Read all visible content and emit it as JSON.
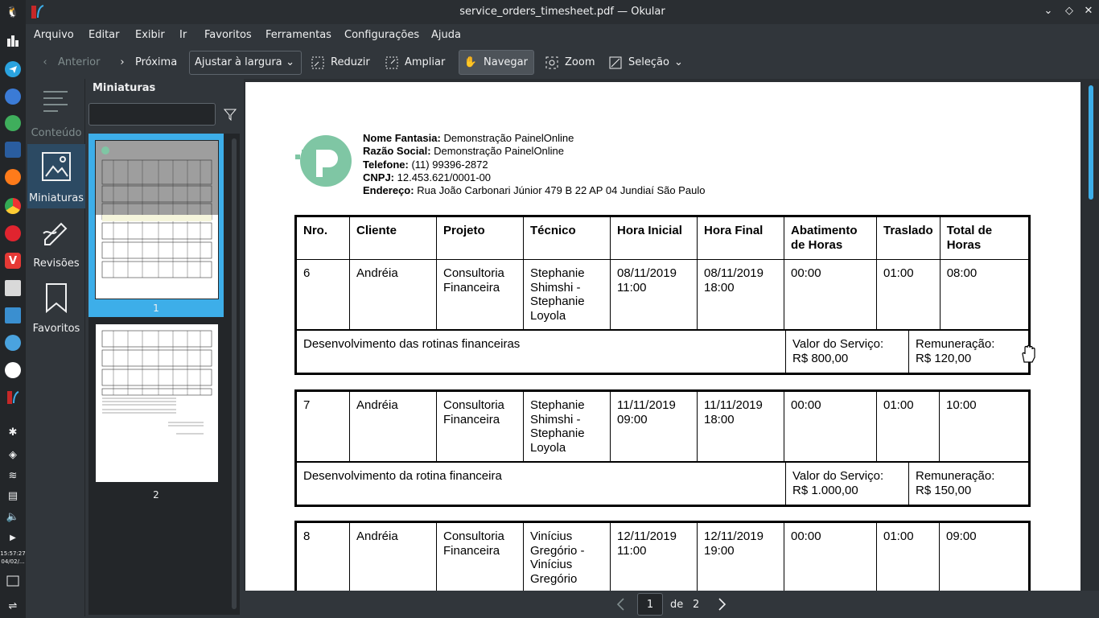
{
  "window": {
    "title": "service_orders_timesheet.pdf — Okular"
  },
  "menu": [
    "Arquivo",
    "Editar",
    "Exibir",
    "Ir",
    "Favoritos",
    "Ferramentas",
    "Configurações",
    "Ajuda"
  ],
  "toolbar": {
    "previous": "Anterior",
    "next": "Próxima",
    "zoom_mode": "Ajustar à largura",
    "zoom_out": "Reduzir",
    "zoom_in": "Ampliar",
    "browse": "Navegar",
    "zoom": "Zoom",
    "selection": "Seleção"
  },
  "sidebar": {
    "tabs": [
      {
        "label": "Conteúdo",
        "icon": "contents-icon"
      },
      {
        "label": "Miniaturas",
        "icon": "thumbnails-icon"
      },
      {
        "label": "Revisões",
        "icon": "reviews-icon"
      },
      {
        "label": "Favoritos",
        "icon": "bookmark-icon"
      }
    ],
    "panel_title": "Miniaturas",
    "thumbnails": [
      {
        "page": "1"
      },
      {
        "page": "2"
      }
    ]
  },
  "taskbar": {
    "clock_time": "15:57:27",
    "clock_date": "04/02/..."
  },
  "document": {
    "company": {
      "fantasy_label": "Nome Fantasia:",
      "fantasy": "Demonstração PainelOnline",
      "social_label": "Razão Social:",
      "social": "Demonstração PainelOnline",
      "phone_label": "Telefone:",
      "phone": "(11) 99396-2872",
      "cnpj_label": "CNPJ:",
      "cnpj": "12.453.621/0001-00",
      "address_label": "Endereço:",
      "address": "Rua João Carbonari Júnior 479 B 22 AP 04 Jundiaí São Paulo"
    },
    "headers": [
      "Nro.",
      "Cliente",
      "Projeto",
      "Técnico",
      "Hora Inicial",
      "Hora Final",
      "Abatimento de Horas",
      "Traslado",
      "Total de Horas"
    ],
    "orders": [
      {
        "nro": "6",
        "cliente": "Andréia",
        "projeto": "Consultoria Financeira",
        "tecnico": "Stephanie Shimshi - Stephanie Loyola",
        "inicio": "08/11/2019 11:00",
        "fim": "08/11/2019 18:00",
        "abatimento": "00:00",
        "traslado": "01:00",
        "total": "08:00",
        "descricao": "Desenvolvimento das rotinas financeiras",
        "valor_label": "Valor do Serviço:",
        "valor": "R$ 800,00",
        "remuneracao_label": "Remuneração:",
        "remuneracao": "R$ 120,00"
      },
      {
        "nro": "7",
        "cliente": "Andréia",
        "projeto": "Consultoria Financeira",
        "tecnico": "Stephanie Shimshi - Stephanie Loyola",
        "inicio": "11/11/2019 09:00",
        "fim": "11/11/2019 18:00",
        "abatimento": "00:00",
        "traslado": "01:00",
        "total": "10:00",
        "descricao": "Desenvolvimento da rotina financeira",
        "valor_label": "Valor do Serviço:",
        "valor": "R$ 1.000,00",
        "remuneracao_label": "Remuneração:",
        "remuneracao": "R$ 150,00"
      },
      {
        "nro": "8",
        "cliente": "Andréia",
        "projeto": "Consultoria Financeira",
        "tecnico": "Vinícius Gregório - Vinícius Gregório",
        "inicio": "12/11/2019 11:00",
        "fim": "12/11/2019 19:00",
        "abatimento": "00:00",
        "traslado": "01:00",
        "total": "09:00"
      }
    ]
  },
  "navigation": {
    "current_page": "1",
    "of_label": "de",
    "total_pages": "2"
  }
}
